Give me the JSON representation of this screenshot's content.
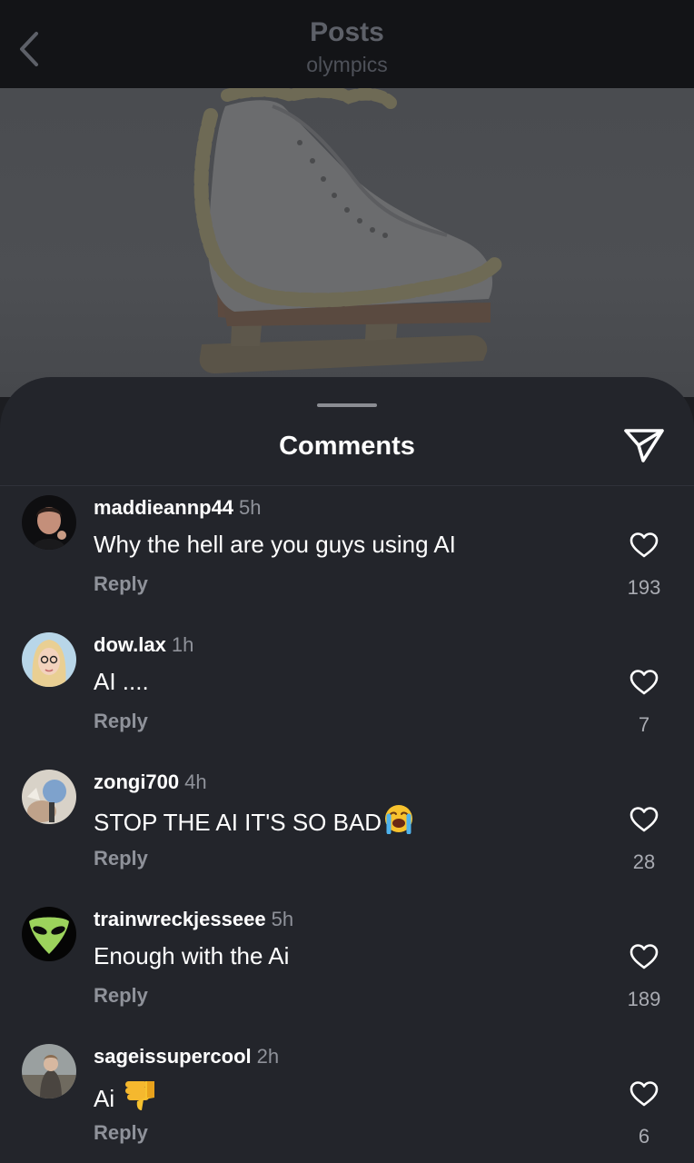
{
  "header": {
    "title": "Posts",
    "subtitle": "olympics",
    "back_icon": "chevron-left-icon"
  },
  "sheet": {
    "title": "Comments",
    "share_icon": "send-icon"
  },
  "comments": [
    {
      "username": "maddieannp44",
      "time": "5h",
      "text": "Why the hell are you guys using AI",
      "emoji": "",
      "reply_label": "Reply",
      "likes": "193"
    },
    {
      "username": "dow.lax",
      "time": "1h",
      "text": "AI ....",
      "emoji": "",
      "reply_label": "Reply",
      "likes": "7"
    },
    {
      "username": "zongi700",
      "time": "4h",
      "text": "STOP THE AI IT'S SO BAD",
      "emoji": "loudly-crying-face-emoji",
      "reply_label": "Reply",
      "likes": "28"
    },
    {
      "username": "trainwreckjesseee",
      "time": "5h",
      "text": "Enough with the Ai",
      "emoji": "",
      "reply_label": "Reply",
      "likes": "189"
    },
    {
      "username": "sageissupercool",
      "time": "2h",
      "text": "Ai",
      "emoji": "thumbs-down-emoji",
      "reply_label": "Reply",
      "likes": "6"
    }
  ],
  "colors": {
    "background": "#23252b",
    "header_background": "#131417",
    "secondary_text": "#8f929a"
  }
}
